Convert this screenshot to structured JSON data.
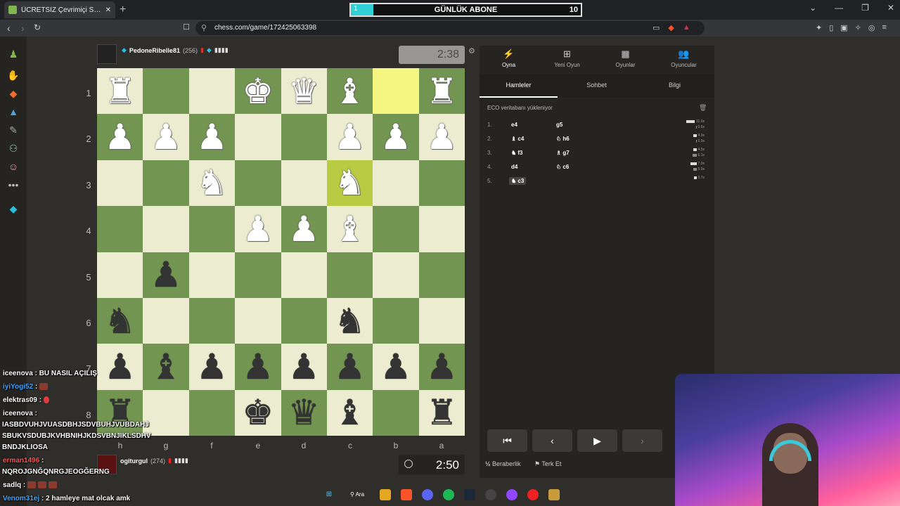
{
  "browser": {
    "tab_title": "ÜCRETSİZ Çevrimiçi Satranç Oyna",
    "url": "chess.com/game/172425063398",
    "new_tab": "+",
    "window_controls": [
      "⌄",
      "—",
      "❐",
      "✕"
    ]
  },
  "overlay": {
    "sub_goal_title": "GÜNLÜK ABONE",
    "sub_goal_current": "1",
    "sub_goal_target": "10"
  },
  "top_player": {
    "name": "PedoneRibelle81",
    "rating": "(256)",
    "clock": "2:38"
  },
  "bottom_player": {
    "name": "ogiturgul",
    "rating": "(274)",
    "clock": "2:50"
  },
  "board": {
    "ranks": [
      "1",
      "2",
      "3",
      "4",
      "5",
      "6",
      "7",
      "8"
    ],
    "files": [
      "h",
      "g",
      "f",
      "e",
      "d",
      "c",
      "b",
      "a"
    ],
    "squares": [
      [
        "wR",
        "",
        "",
        "wK",
        "wQ",
        "wB",
        "hl",
        "wR"
      ],
      [
        "wP",
        "wP",
        "wP",
        "",
        "",
        "wP",
        "wP",
        "wP"
      ],
      [
        "",
        "",
        "wN",
        "",
        "",
        "wN*",
        "",
        ""
      ],
      [
        "",
        "",
        "",
        "wP",
        "wP",
        "wB",
        "",
        ""
      ],
      [
        "",
        "bP",
        "",
        "",
        "",
        "",
        "",
        ""
      ],
      [
        "bN",
        "",
        "",
        "",
        "",
        "bN",
        "",
        ""
      ],
      [
        "bP",
        "bB",
        "bP",
        "bP",
        "bP",
        "bP",
        "bP",
        "bP"
      ],
      [
        "bR",
        "",
        "",
        "bK",
        "bQ",
        "bB",
        "",
        "bR"
      ]
    ]
  },
  "panel": {
    "tabs": [
      {
        "label": "Oyna",
        "icon": "lightning-icon"
      },
      {
        "label": "Yeni Oyun",
        "icon": "plus-icon"
      },
      {
        "label": "Oyunlar",
        "icon": "board-icon"
      },
      {
        "label": "Oyuncular",
        "icon": "players-icon"
      }
    ],
    "subtabs": [
      "Hamleler",
      "Sohbet",
      "Bilgi"
    ],
    "eco_text": "ECO veritabanı yükleniyor",
    "moves": [
      {
        "num": "1.",
        "white": "e4",
        "black": "g5",
        "wt": "11.0s",
        "bt": "0.6s"
      },
      {
        "num": "2.",
        "white": "♝ c4",
        "black": "♘ h6",
        "wt": "4.9s",
        "bt": "0.9s"
      },
      {
        "num": "3.",
        "white": "♞ f3",
        "black": "♗ g7",
        "wt": "4.5s",
        "bt": "6.1s"
      },
      {
        "num": "4.",
        "white": "d4",
        "black": "♘ c6",
        "wt": "7.9s",
        "bt": "5.0s"
      },
      {
        "num": "5.",
        "white": "♞ c3",
        "black": "",
        "wt": "3.7s",
        "bt": ""
      }
    ],
    "controls": [
      "⏮",
      "‹",
      "▶",
      "›"
    ],
    "draw_label": "Beraberlik",
    "draw_icon_text": "½",
    "resign_label": "Terk Et"
  },
  "chat": [
    {
      "user": "iceenova",
      "text": ": BU NASIL AÇILIŞ"
    },
    {
      "user": "iyiYogi52",
      "text": ":"
    },
    {
      "user": "elektras09",
      "text": ":"
    },
    {
      "user": "iceenova",
      "text": ":"
    },
    {
      "user": "",
      "text": "IASBDVUHJVUASDBHJSDVBUHJVUBDAHJ"
    },
    {
      "user": "",
      "text": "SBUKVSDUBJKVHBNIHJKDSVBNJIKLSDHV"
    },
    {
      "user": "",
      "text": "BNDJKLIOSA"
    },
    {
      "user": "erman1496",
      "text": ":"
    },
    {
      "user": "",
      "text": "NQROJGNĞQNRGJEOGĞERNG"
    },
    {
      "user": "sadlq",
      "text": ":"
    },
    {
      "user": "Venom31ej",
      "text": ": 2 hamleye mat olcak amk"
    }
  ],
  "taskbar": {
    "search": "Ara"
  },
  "colors": {
    "light_square": "#ebecd0",
    "dark_square": "#739552",
    "highlight": "#f5f682",
    "panel_bg": "#262421"
  }
}
